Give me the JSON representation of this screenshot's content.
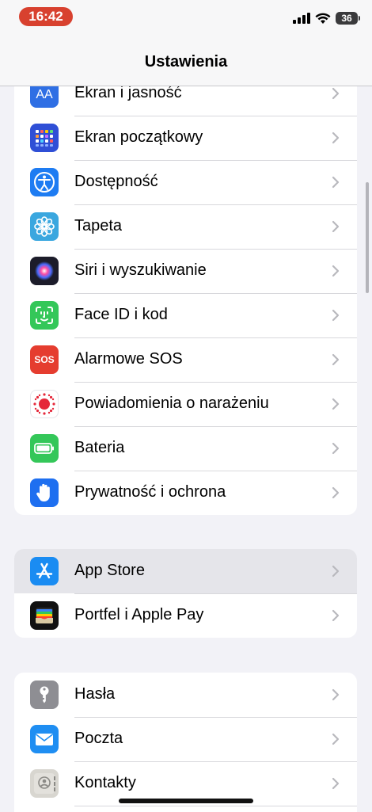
{
  "status_bar": {
    "time": "16:42",
    "battery": "36"
  },
  "nav": {
    "title": "Ustawienia"
  },
  "group1": [
    {
      "label": "Ekran i jasność",
      "icon": "aa-icon",
      "color": "#2f6fe4"
    },
    {
      "label": "Ekran początkowy",
      "icon": "home-screen-icon",
      "color": "#2f4fd6"
    },
    {
      "label": "Dostępność",
      "icon": "accessibility-icon",
      "color": "#1e7cf2"
    },
    {
      "label": "Tapeta",
      "icon": "wallpaper-flower-icon",
      "color": "#3aa7df"
    },
    {
      "label": "Siri i wyszukiwanie",
      "icon": "siri-icon",
      "color": "#1c1c2a"
    },
    {
      "label": "Face ID i kod",
      "icon": "face-id-icon",
      "color": "#34c759"
    },
    {
      "label": "Alarmowe SOS",
      "icon": "sos-icon",
      "color": "#e53d2f",
      "icon_text": "SOS"
    },
    {
      "label": "Powiadomienia o narażeniu",
      "icon": "exposure-icon",
      "color": "#ffffff"
    },
    {
      "label": "Bateria",
      "icon": "battery-icon",
      "color": "#34c759"
    },
    {
      "label": "Prywatność i ochrona",
      "icon": "hand-icon",
      "color": "#1e6ff0"
    }
  ],
  "group2": [
    {
      "label": "App Store",
      "icon": "app-store-icon",
      "color": "#1a8cf2"
    },
    {
      "label": "Portfel i Apple Pay",
      "icon": "wallet-icon",
      "color": "#111111"
    }
  ],
  "group3": [
    {
      "label": "Hasła",
      "icon": "key-icon",
      "color": "#8e8e93"
    },
    {
      "label": "Poczta",
      "icon": "mail-icon",
      "color": "#1f8ef2"
    },
    {
      "label": "Kontakty",
      "icon": "contacts-icon",
      "color": "#d8d6d0"
    }
  ]
}
